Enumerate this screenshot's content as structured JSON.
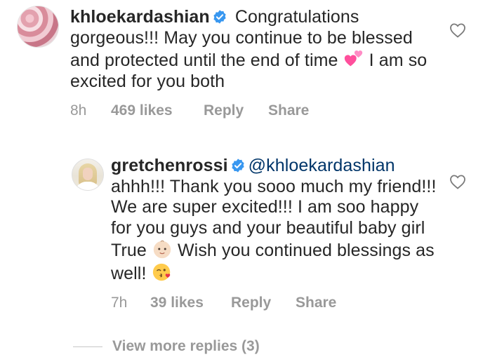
{
  "comments": [
    {
      "username": "khloekardashian",
      "text_parts": {
        "a": "Congratulations gorgeous!!! May you continue to be blessed and protected until the end of time",
        "b": "I am so excited for you both"
      },
      "time": "8h",
      "likes": "469 likes",
      "reply": "Reply",
      "share": "Share"
    },
    {
      "username": "gretchenrossi",
      "mention": "@khloekardashian",
      "text_parts": {
        "a": "ahhh!!! Thank you sooo much my friend!!! We are super excited!!! I am soo happy for you guys and your beautiful baby girl True",
        "b": "Wish you continued blessings as well!"
      },
      "time": "7h",
      "likes": "39 likes",
      "reply": "Reply",
      "share": "Share"
    }
  ],
  "view_more": "View more replies (3)",
  "icons": {
    "verified": "verified-badge-icon",
    "heart": "heart-outline-icon",
    "emoji_hearts": "two-hearts-emoji",
    "emoji_baby": "baby-emoji",
    "emoji_kiss": "kissing-face-emoji"
  },
  "colors": {
    "verified": "#3897f0",
    "meta": "#999999",
    "mention": "#003569",
    "emoji_pink": "#ff5fa8"
  }
}
